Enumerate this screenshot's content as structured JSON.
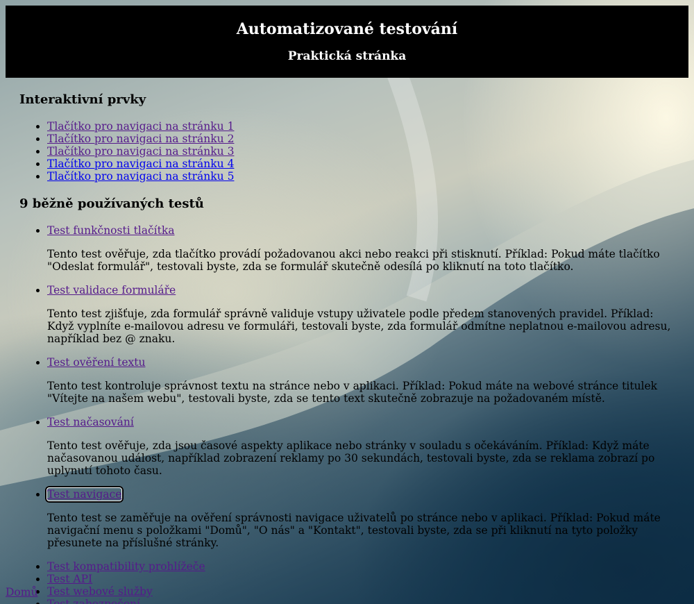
{
  "header": {
    "title": "Automatizované testování",
    "subtitle": "Praktická stránka"
  },
  "interactive": {
    "heading": "Interaktivní prvky",
    "links": [
      "Tlačítko pro navigaci na stránku 1",
      "Tlačítko pro navigaci na stránku 2",
      "Tlačítko pro navigaci na stránku 3",
      "Tlačítko pro navigaci na stránku 4",
      "Tlačítko pro navigaci na stránku 5"
    ]
  },
  "tests": {
    "heading": "9 běžně používaných testů",
    "items": [
      {
        "label": "Test funkčnosti tlačítka",
        "description": "Tento test ověřuje, zda tlačítko provádí požadovanou akci nebo reakci při stisknutí. Příklad: Pokud máte tlačítko \"Odeslat formulář\", testovali byste, zda se formulář skutečně odesílá po kliknutí na toto tlačítko."
      },
      {
        "label": "Test validace formuláře",
        "description": "Tento test zjišťuje, zda formulář správně validuje vstupy uživatele podle předem stanovených pravidel. Příklad: Když vyplníte e-mailovou adresu ve formuláři, testovali byste, zda formulář odmítne neplatnou e-mailovou adresu, například bez @ znaku."
      },
      {
        "label": "Test ověření textu",
        "description": "Tento test kontroluje správnost textu na stránce nebo v aplikaci. Příklad: Pokud máte na webové stránce titulek \"Vítejte na našem webu\", testovali byste, zda se tento text skutečně zobrazuje na požadovaném místě."
      },
      {
        "label": "Test načasování",
        "description": "Tento test ověřuje, zda jsou časové aspekty aplikace nebo stránky v souladu s očekáváním. Příklad: Když máte načasovanou událost, například zobrazení reklamy po 30 sekundách, testovali byste, zda se reklama zobrazí po uplynutí tohoto času."
      },
      {
        "label": "Test navigace",
        "description": "Tento test se zaměřuje na ověření správnosti navigace uživatelů po stránce nebo v aplikaci. Příklad: Pokud máte navigační menu s položkami \"Domů\", \"O nás\" a \"Kontakt\", testovali byste, zda se při kliknutí na tyto položky přesunete na příslušné stránky."
      }
    ],
    "more": [
      "Test kompatibility prohlížeče",
      "Test API",
      "Test webové služby",
      "Test zabezpečení"
    ]
  },
  "footer": {
    "home_link": "Domů"
  }
}
